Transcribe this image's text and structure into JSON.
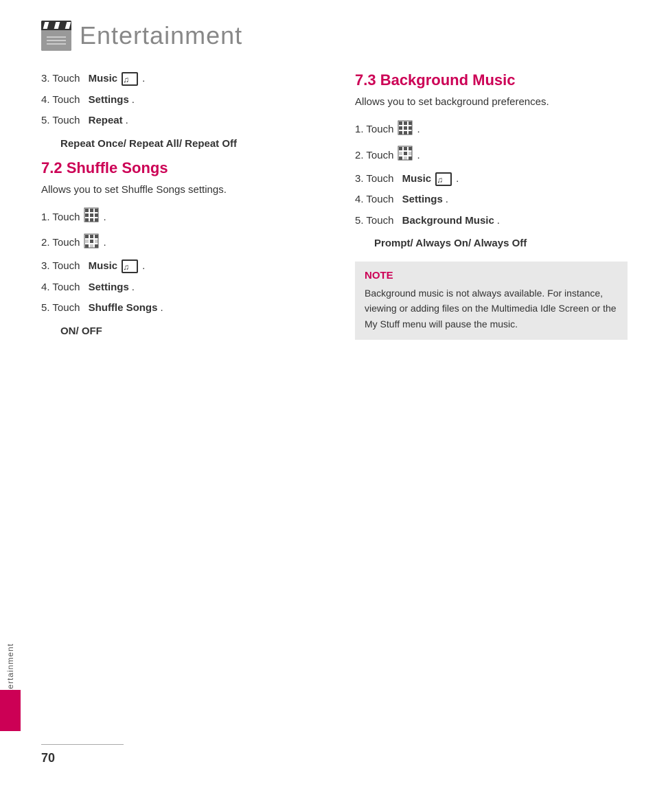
{
  "header": {
    "title": "Entertainment",
    "icon_alt": "entertainment-icon"
  },
  "sidebar": {
    "label": "Entertainment"
  },
  "page_number": "70",
  "left_col": {
    "steps_intro": [
      {
        "num": "3.",
        "text": "Touch ",
        "bold": "Music",
        "has_music_icon": true,
        "suffix": "."
      },
      {
        "num": "4.",
        "text": "Touch ",
        "bold": "Settings",
        "suffix": "."
      },
      {
        "num": "5.",
        "text": "Touch ",
        "bold": "Repeat",
        "suffix": "."
      }
    ],
    "repeat_note": "Repeat Once/ Repeat All/ Repeat Off",
    "section_heading": "7.2  Shuffle Songs",
    "section_desc": "Allows you to set Shuffle Songs settings.",
    "shuffle_steps": [
      {
        "num": "1.",
        "text": "Touch",
        "icon_type": "grid1",
        "suffix": "."
      },
      {
        "num": "2.",
        "text": "Touch",
        "icon_type": "grid2",
        "suffix": "."
      },
      {
        "num": "3.",
        "text": "Touch ",
        "bold": "Music",
        "has_music_icon": true,
        "suffix": "."
      },
      {
        "num": "4.",
        "text": "Touch ",
        "bold": "Settings",
        "suffix": "."
      },
      {
        "num": "5.",
        "text": "Touch ",
        "bold": "Shuffle Songs",
        "suffix": "."
      }
    ],
    "on_off_note": "ON/ OFF"
  },
  "right_col": {
    "section_heading": "7.3  Background Music",
    "section_desc": "Allows you to set background preferences.",
    "bg_steps": [
      {
        "num": "1.",
        "text": "Touch",
        "icon_type": "grid1",
        "suffix": "."
      },
      {
        "num": "2.",
        "text": "Touch",
        "icon_type": "grid2",
        "suffix": "."
      },
      {
        "num": "3.",
        "text": "Touch ",
        "bold": "Music",
        "has_music_icon": true,
        "suffix": "."
      },
      {
        "num": "4.",
        "text": "Touch ",
        "bold": "Settings",
        "suffix": "."
      },
      {
        "num": "5.",
        "text": "Touch ",
        "bold": "Background Music",
        "suffix": "."
      }
    ],
    "prompt_note": "Prompt/ Always On/ Always Off",
    "note_label": "NOTE",
    "note_text": "Background music is not always available. For instance, viewing or adding files on the Multimedia Idle Screen or the My Stuff menu will pause the music."
  }
}
